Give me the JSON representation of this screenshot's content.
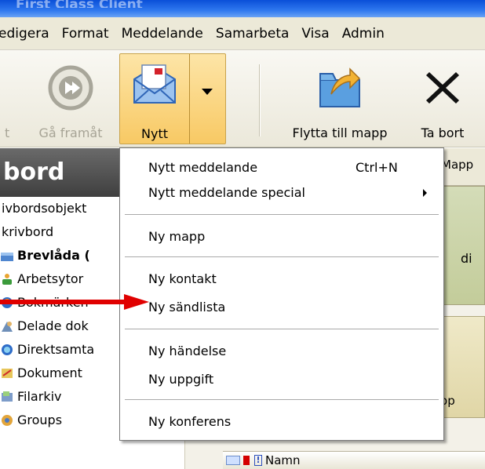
{
  "window": {
    "title": "First Class Client"
  },
  "menubar": {
    "items": [
      "edigera",
      "Format",
      "Meddelande",
      "Samarbeta",
      "Visa",
      "Admin"
    ]
  },
  "toolbar": {
    "back_label": "t",
    "forward_label": "Gå framåt",
    "new_label": "Nytt",
    "move_label": "Flytta till mapp",
    "delete_label": "Ta bort"
  },
  "sidebar": {
    "header": "bord",
    "items": [
      {
        "label": "ivbordsobjekt",
        "icon": "none",
        "bold": false
      },
      {
        "label": "krivbord",
        "icon": "none",
        "bold": false
      },
      {
        "label": "Brevlåda (",
        "icon": "mailbox-icon",
        "bold": true
      },
      {
        "label": "Arbetsytor",
        "icon": "workspace-icon",
        "bold": false
      },
      {
        "label": "Bokmärken",
        "icon": "bookmark-icon",
        "bold": false
      },
      {
        "label": "Delade dok",
        "icon": "shared-docs-icon",
        "bold": false
      },
      {
        "label": "Direktsamta",
        "icon": "chat-icon",
        "bold": false
      },
      {
        "label": "Dokument",
        "icon": "document-icon",
        "bold": false
      },
      {
        "label": "Filarkiv",
        "icon": "file-archive-icon",
        "bold": false
      },
      {
        "label": "Groups",
        "icon": "groups-icon",
        "bold": false
      }
    ]
  },
  "content": {
    "tab_label": "Mapp",
    "panel1_text": "di",
    "panel2_text": "rupp",
    "column_name": "Namn"
  },
  "menu": {
    "items": [
      {
        "label": "Nytt meddelande",
        "shortcut": "Ctrl+N",
        "submenu": false
      },
      {
        "label": "Nytt meddelande special",
        "shortcut": "",
        "submenu": true
      },
      {
        "label": "Ny mapp",
        "shortcut": "",
        "submenu": false
      },
      {
        "label": "Ny kontakt",
        "shortcut": "",
        "submenu": false
      },
      {
        "label": "Ny sändlista",
        "shortcut": "",
        "submenu": false
      },
      {
        "label": "Ny händelse",
        "shortcut": "",
        "submenu": false
      },
      {
        "label": "Ny uppgift",
        "shortcut": "",
        "submenu": false
      },
      {
        "label": "Ny konferens",
        "shortcut": "",
        "submenu": false
      }
    ]
  },
  "colors": {
    "annotation_arrow": "#e00000",
    "new_button_highlight": "#f8c964",
    "sidebar_header": "#4a4a4a"
  }
}
